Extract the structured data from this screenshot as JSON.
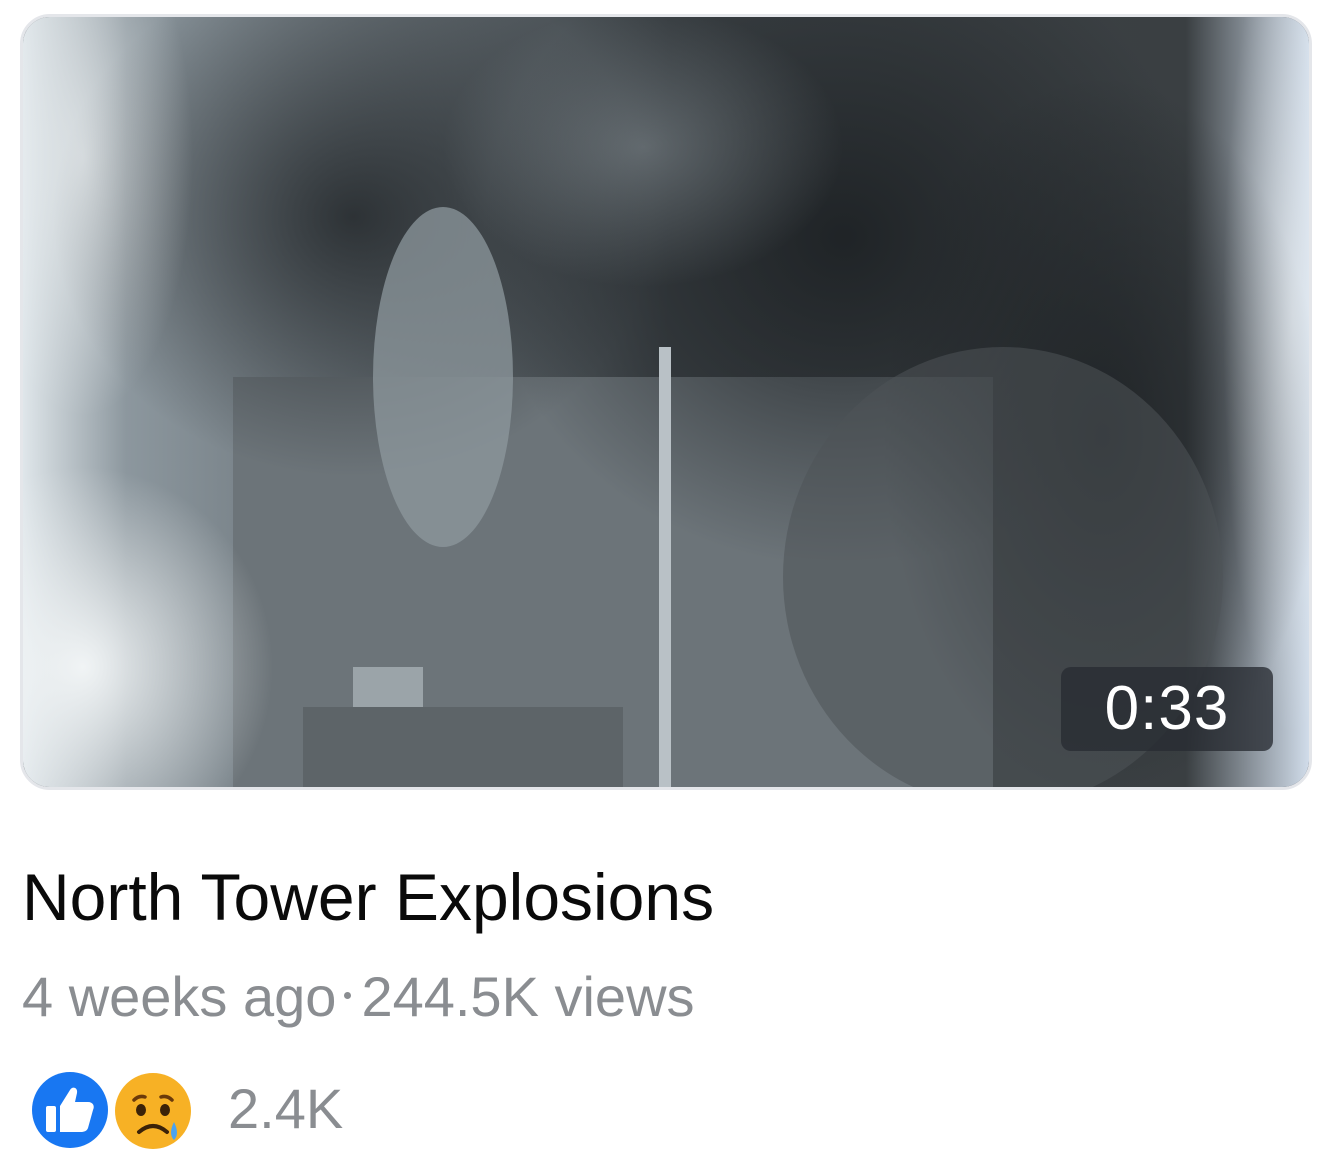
{
  "video": {
    "thumbnail_icon": "video-thumbnail-smoke-building",
    "duration": "0:33"
  },
  "title": "North Tower Explosions",
  "meta": {
    "posted": "4 weeks ago",
    "views": "244.5K views"
  },
  "reactions": {
    "types": [
      "like-icon",
      "sad-icon"
    ],
    "count": "2.4K"
  },
  "colors": {
    "like_blue": "#1877f2",
    "sad_yellow": "#f7b125",
    "muted_text": "#8a8d91"
  }
}
